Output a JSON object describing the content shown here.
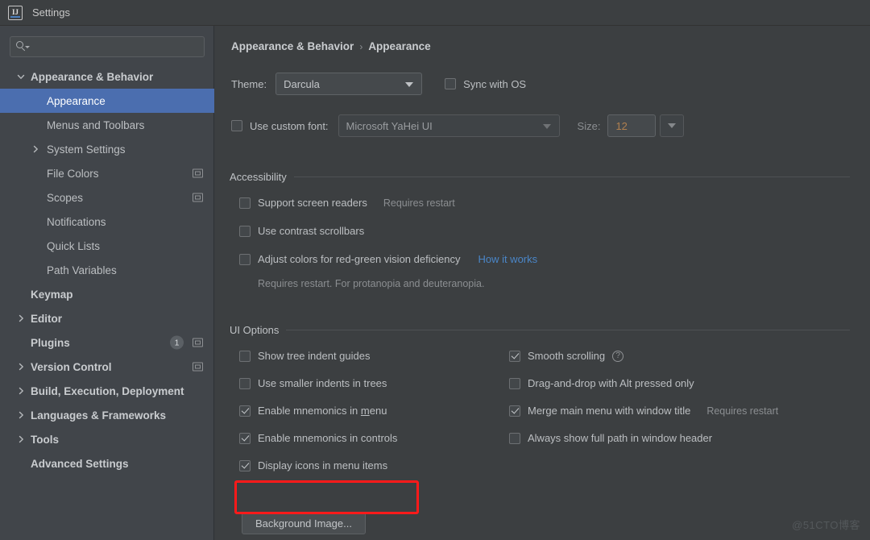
{
  "window": {
    "title": "Settings",
    "logo_icon": "intellij-idea-logo"
  },
  "sidebar": {
    "search": {
      "placeholder": "",
      "value": "",
      "icon": "search-icon"
    },
    "items": [
      {
        "label": "Appearance & Behavior",
        "level": 0,
        "arrow": "down",
        "bold": true,
        "selected": false
      },
      {
        "label": "Appearance",
        "level": 1,
        "arrow": "none",
        "bold": false,
        "selected": true
      },
      {
        "label": "Menus and Toolbars",
        "level": 1,
        "arrow": "none",
        "bold": false,
        "selected": false
      },
      {
        "label": "System Settings",
        "level": 1,
        "arrow": "right",
        "bold": false,
        "selected": false
      },
      {
        "label": "File Colors",
        "level": 1,
        "arrow": "none",
        "bold": false,
        "selected": false,
        "scope_icon": true
      },
      {
        "label": "Scopes",
        "level": 1,
        "arrow": "none",
        "bold": false,
        "selected": false,
        "scope_icon": true
      },
      {
        "label": "Notifications",
        "level": 1,
        "arrow": "none",
        "bold": false,
        "selected": false
      },
      {
        "label": "Quick Lists",
        "level": 1,
        "arrow": "none",
        "bold": false,
        "selected": false
      },
      {
        "label": "Path Variables",
        "level": 1,
        "arrow": "none",
        "bold": false,
        "selected": false
      },
      {
        "label": "Keymap",
        "level": 0,
        "arrow": "none",
        "bold": true,
        "selected": false
      },
      {
        "label": "Editor",
        "level": 0,
        "arrow": "right",
        "bold": true,
        "selected": false
      },
      {
        "label": "Plugins",
        "level": 0,
        "arrow": "none",
        "bold": true,
        "selected": false,
        "badge": "1",
        "scope_icon": true
      },
      {
        "label": "Version Control",
        "level": 0,
        "arrow": "right",
        "bold": true,
        "selected": false,
        "scope_icon": true
      },
      {
        "label": "Build, Execution, Deployment",
        "level": 0,
        "arrow": "right",
        "bold": true,
        "selected": false
      },
      {
        "label": "Languages & Frameworks",
        "level": 0,
        "arrow": "right",
        "bold": true,
        "selected": false
      },
      {
        "label": "Tools",
        "level": 0,
        "arrow": "right",
        "bold": true,
        "selected": false
      },
      {
        "label": "Advanced Settings",
        "level": 0,
        "arrow": "none",
        "bold": true,
        "selected": false
      }
    ]
  },
  "breadcrumb": {
    "root": "Appearance & Behavior",
    "separator": "›",
    "current": "Appearance"
  },
  "theme_row": {
    "label": "Theme:",
    "value": "Darcula",
    "sync_with_os": {
      "label": "Sync with OS",
      "checked": false
    }
  },
  "font_row": {
    "use_custom_font": {
      "label": "Use custom font:",
      "checked": false
    },
    "font_value": "Microsoft YaHei UI",
    "size_label": "Size:",
    "size_value": "12"
  },
  "accessibility": {
    "title": "Accessibility",
    "options": [
      {
        "label": "Support screen readers",
        "checked": false,
        "note": "Requires restart"
      },
      {
        "label": "Use contrast scrollbars",
        "checked": false,
        "note": ""
      },
      {
        "label": "Adjust colors for red-green vision deficiency",
        "checked": false,
        "link": "How it works"
      }
    ],
    "sub_note": "Requires restart. For protanopia and deuteranopia."
  },
  "ui_options": {
    "title": "UI Options",
    "left_column": [
      {
        "label": "Show tree indent guides",
        "checked": false
      },
      {
        "label": "Use smaller indents in trees",
        "checked": false
      },
      {
        "label_pre": "Enable mnemonics in ",
        "mnemonic": "m",
        "label_post": "enu",
        "checked": true
      },
      {
        "label": "Enable mnemonics in controls",
        "checked": true
      },
      {
        "label": "Display icons in menu items",
        "checked": true
      }
    ],
    "right_column": [
      {
        "label": "Smooth scrolling",
        "checked": true,
        "help_icon": "?"
      },
      {
        "label": "Drag-and-drop with Alt pressed only",
        "checked": false
      },
      {
        "label": "Merge main menu with window title",
        "checked": true,
        "note": "Requires restart"
      },
      {
        "label": "Always show full path in window header",
        "checked": false
      }
    ],
    "background_image_button": "Background Image..."
  },
  "annotation": {
    "color": "#ff1a1a"
  },
  "watermark": "@51CTO博客",
  "colors": {
    "window_bg": "#3c3f41",
    "sidebar_bg": "#41454a",
    "selection": "#4b6eaf",
    "link": "#4a86c8",
    "text": "#bcbfc2"
  }
}
